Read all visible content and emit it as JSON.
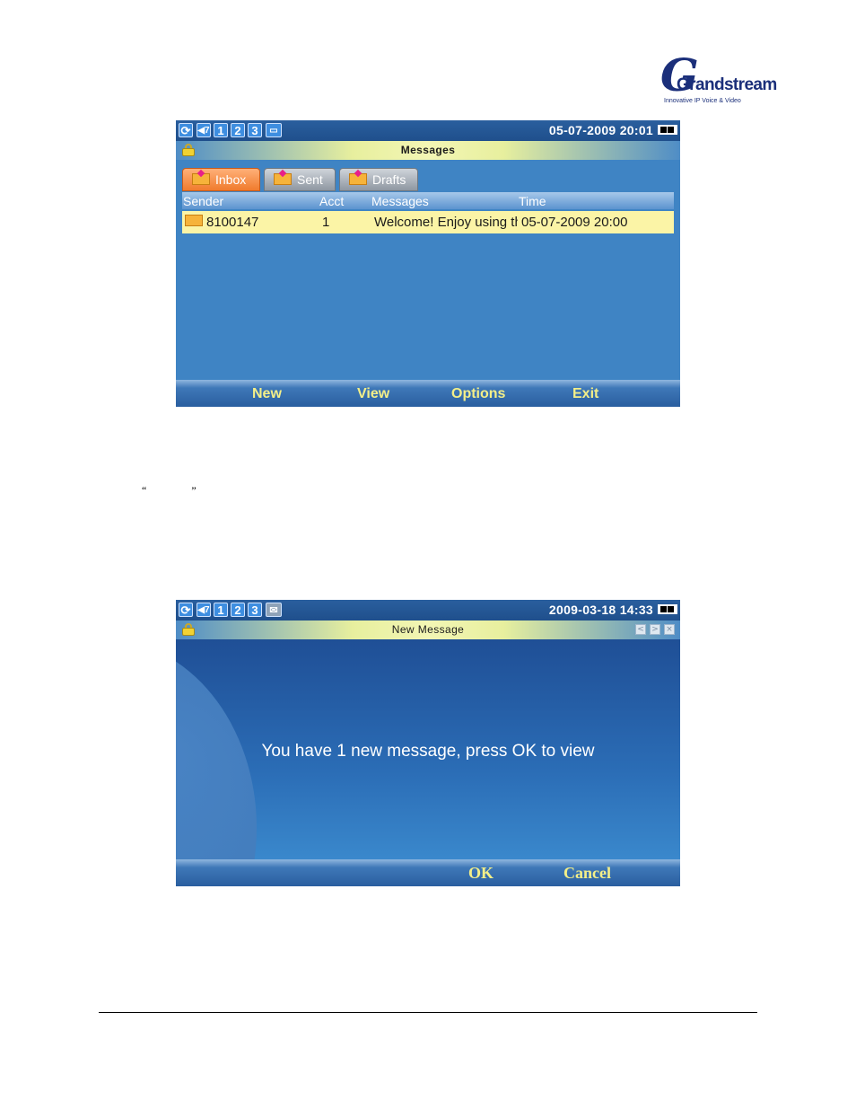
{
  "logo": {
    "brand": "Grandstream",
    "tagline": "Innovative IP Voice & Video"
  },
  "screen1": {
    "status": {
      "icons": [
        "refresh-icon",
        "volume-icon",
        "1",
        "2",
        "3",
        "folder-icon"
      ],
      "datetime": "05-07-2009 20:01"
    },
    "title": "Messages",
    "tabs": [
      {
        "label": "Inbox"
      },
      {
        "label": "Sent"
      },
      {
        "label": "Drafts"
      }
    ],
    "columns": [
      "Sender",
      "Acct",
      "Messages",
      "Time"
    ],
    "rows": [
      {
        "sender": "8100147",
        "acct": "1",
        "message": "Welcome! Enjoy using th",
        "time": "05-07-2009 20:00"
      }
    ],
    "softkeys": [
      "New",
      "View",
      "Options",
      "Exit"
    ]
  },
  "quotes": {
    "open": "“",
    "close": "”"
  },
  "screen2": {
    "status": {
      "icons": [
        "refresh-icon",
        "volume-icon",
        "1",
        "2",
        "3",
        "mail-icon"
      ],
      "datetime": "2009-03-18 14:33"
    },
    "title": "New Message",
    "window_buttons": [
      "<",
      ">",
      "×"
    ],
    "message": "You have 1 new message, press OK to view",
    "softkeys": [
      "OK",
      "Cancel"
    ]
  }
}
